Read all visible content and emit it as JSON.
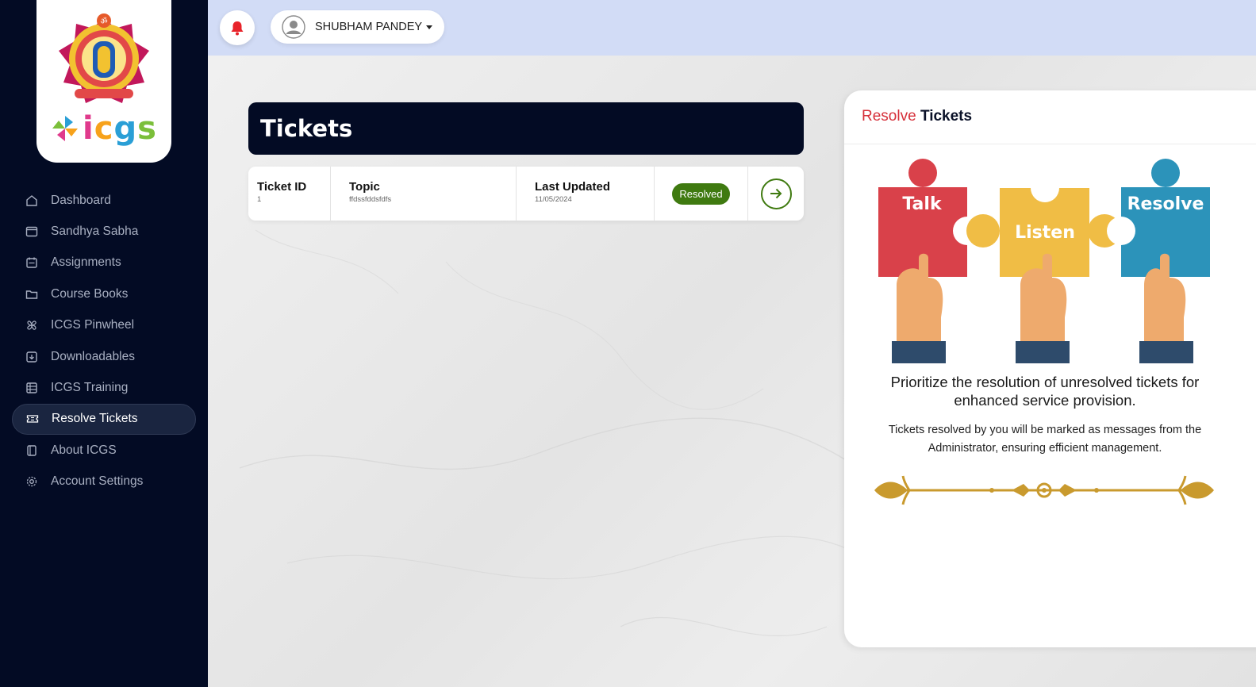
{
  "brand": {
    "name": "icgs",
    "letters": [
      "i",
      "c",
      "g",
      "s"
    ]
  },
  "header": {
    "user_name": "SHUBHAM PANDEY"
  },
  "sidebar": {
    "items": [
      {
        "label": "Dashboard",
        "icon": "home-icon",
        "active": false
      },
      {
        "label": "Sandhya Sabha",
        "icon": "window-icon",
        "active": false
      },
      {
        "label": "Assignments",
        "icon": "calendar-icon",
        "active": false
      },
      {
        "label": "Course Books",
        "icon": "folder-icon",
        "active": false
      },
      {
        "label": "ICGS Pinwheel",
        "icon": "pinwheel-icon",
        "active": false
      },
      {
        "label": "Downloadables",
        "icon": "download-box-icon",
        "active": false
      },
      {
        "label": "ICGS Training",
        "icon": "grid-icon",
        "active": false
      },
      {
        "label": "Resolve Tickets",
        "icon": "ticket-icon",
        "active": true
      },
      {
        "label": "About ICGS",
        "icon": "book-icon",
        "active": false
      },
      {
        "label": "Account Settings",
        "icon": "gear-icon",
        "active": false
      }
    ]
  },
  "main": {
    "title": "Tickets",
    "ticket": {
      "id_label": "Ticket ID",
      "id_value": "1",
      "topic_label": "Topic",
      "topic_value": "ffdssfddsfdfs",
      "updated_label": "Last Updated",
      "updated_value": "11/05/2024",
      "status": "Resolved"
    }
  },
  "panel": {
    "title_accent": "Resolve",
    "title_rest": "Tickets",
    "puzzle": {
      "piece1": "Talk",
      "piece2": "Listen",
      "piece3": "Resolve"
    },
    "heading": "Prioritize the resolution of unresolved tickets for enhanced service provision.",
    "description": "Tickets resolved by you will be marked as messages from the Administrator, ensuring efficient management."
  },
  "colors": {
    "sidebar_bg": "#030b24",
    "topbar_bg": "#d2dcf6",
    "accent_red": "#d6303a",
    "status_green": "#3f7a10",
    "puzzle_red": "#d9414a",
    "puzzle_yellow": "#f0bd45",
    "puzzle_blue": "#2c93ba"
  }
}
